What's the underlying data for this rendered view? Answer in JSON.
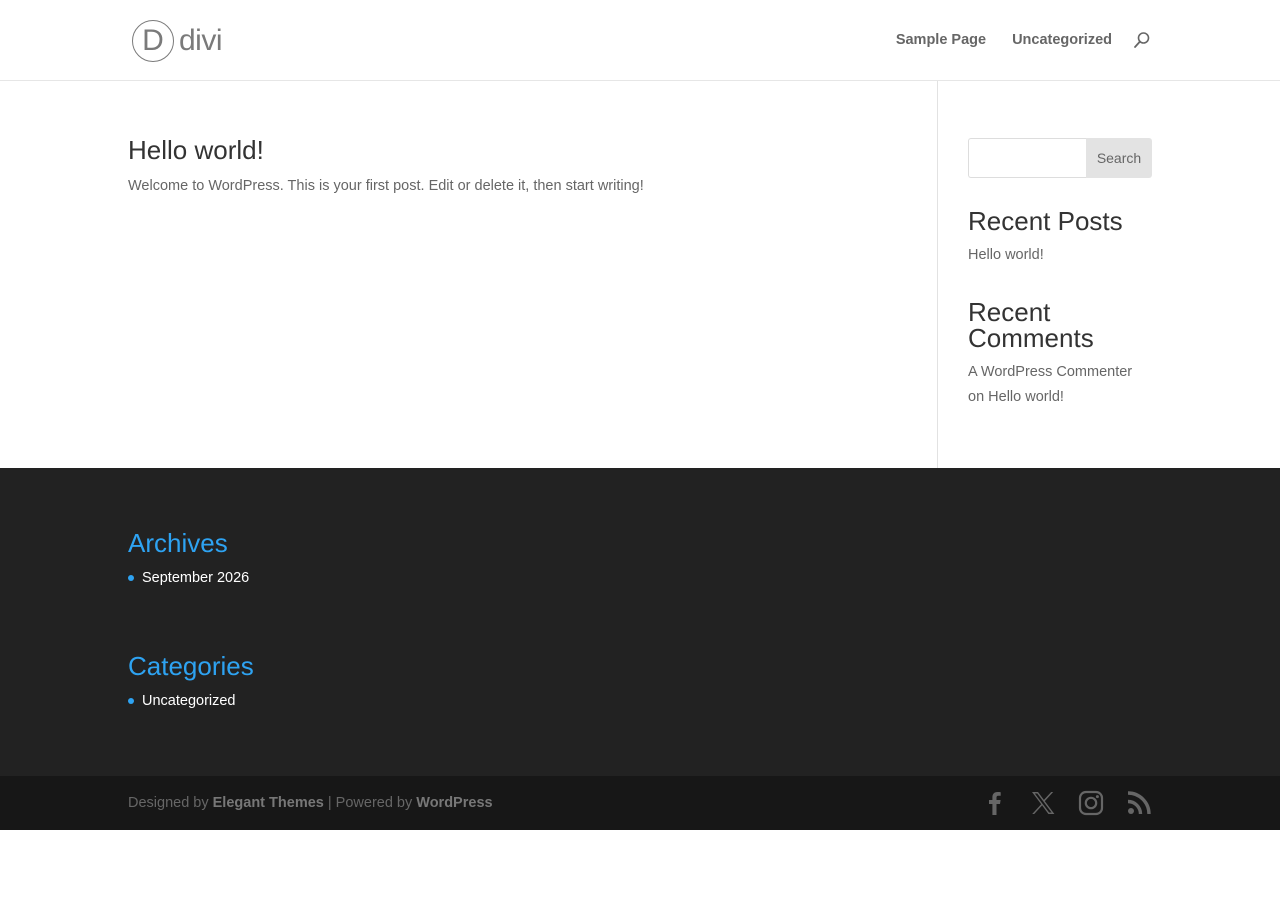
{
  "header": {
    "logo_letter": "D",
    "logo_text": "divi",
    "nav": [
      {
        "label": "Sample Page"
      },
      {
        "label": "Uncategorized"
      }
    ],
    "search_icon": "search-icon"
  },
  "post": {
    "title": "Hello world!",
    "excerpt": "Welcome to WordPress. This is your first post. Edit or delete it, then start writing!"
  },
  "sidebar": {
    "search": {
      "value": "",
      "placeholder": "",
      "button_label": "Search"
    },
    "recent_posts": {
      "title": "Recent Posts",
      "items": [
        "Hello world!"
      ]
    },
    "recent_comments": {
      "title_line1": "Recent",
      "title_line2": "Comments",
      "author": "A WordPress Commenter",
      "on": "on",
      "post": "Hello world!"
    }
  },
  "footer": {
    "archives": {
      "title": "Archives",
      "items": [
        "September 2026"
      ]
    },
    "categories": {
      "title": "Categories",
      "items": [
        "Uncategorized"
      ]
    }
  },
  "bottom_bar": {
    "designed_by": "Designed by",
    "elegant_themes": "Elegant Themes",
    "separator": "| Powered by",
    "wordpress": "WordPress",
    "social_icons": [
      "facebook-icon",
      "x-icon",
      "instagram-icon",
      "rss-icon"
    ]
  },
  "colors": {
    "accent": "#2ea3f2",
    "footer_bg": "#222222",
    "bottom_bar_bg": "#171717",
    "text": "#666666",
    "heading": "#333333"
  }
}
